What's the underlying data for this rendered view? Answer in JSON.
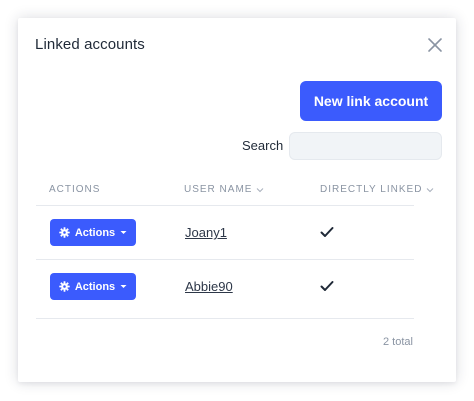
{
  "modal": {
    "title": "Linked accounts",
    "close_icon": "close-x-icon"
  },
  "toolbar": {
    "new_link_label": "New link account",
    "search_label": "Search",
    "search_value": "",
    "search_placeholder": ""
  },
  "table": {
    "columns": [
      {
        "label": "ACTIONS",
        "sortable": false
      },
      {
        "label": "USER NAME",
        "sortable": true
      },
      {
        "label": "DIRECTLY LINKED",
        "sortable": true
      }
    ],
    "rows": [
      {
        "action_label": "Actions",
        "user_name": "Joany1",
        "directly_linked": true
      },
      {
        "action_label": "Actions",
        "user_name": "Abbie90",
        "directly_linked": true
      }
    ]
  },
  "footer": {
    "total_label": "2 total"
  },
  "colors": {
    "primary": "#3b5bfd",
    "text": "#1f2937",
    "muted": "#8a94a3",
    "divider": "#e6e9ee"
  }
}
